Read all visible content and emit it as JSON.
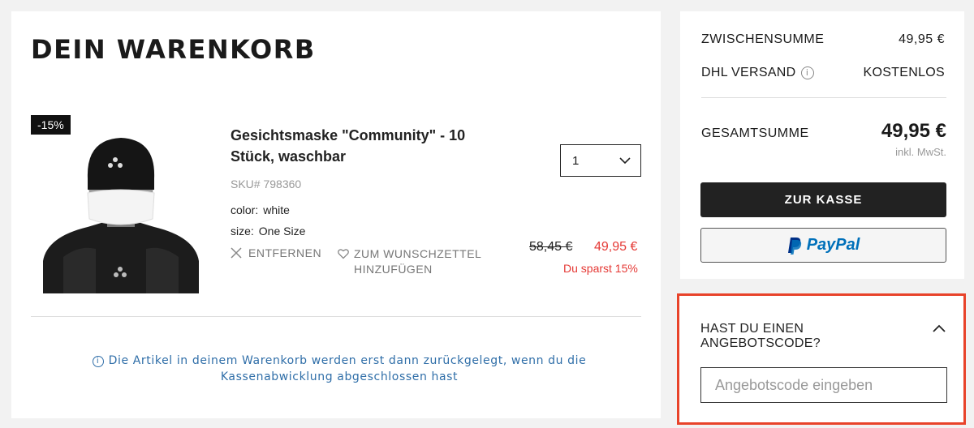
{
  "cart": {
    "title": "DEIN WARENKORB",
    "item": {
      "discount_badge": "-15%",
      "name": "Gesichtsmaske \"Community\" - 10 Stück, waschbar",
      "sku": "SKU# 798360",
      "color_label": "color:",
      "color_value": "white",
      "size_label": "size:",
      "size_value": "One Size",
      "remove_label": "ENTFERNEN",
      "wishlist_label": "ZUM WUNSCHZETTEL HINZUFÜGEN",
      "quantity": "1",
      "price_old": "58,45 €",
      "price_new": "49,95 €",
      "savings": "Du sparst 15%"
    },
    "info_note": "Die Artikel in deinem Warenkorb werden erst dann zurückgelegt, wenn du die Kassenabwicklung abgeschlossen hast"
  },
  "summary": {
    "subtotal_label": "ZWISCHENSUMME",
    "subtotal_value": "49,95 €",
    "shipping_label": "DHL VERSAND",
    "shipping_value": "KOSTENLOS",
    "total_label": "GESAMTSUMME",
    "total_value": "49,95 €",
    "vat_note": "inkl. MwSt.",
    "checkout_label": "ZUR KASSE",
    "paypal_label": "PayPal"
  },
  "promo": {
    "title": "HAST DU EINEN ANGEBOTSCODE?",
    "placeholder": "Angebotscode eingeben"
  },
  "colors": {
    "accent_red": "#e53935",
    "highlight_border": "#e8432a",
    "info_blue": "#2f6ea8",
    "paypal_blue": "#0070ba",
    "paypal_dark": "#003087"
  }
}
